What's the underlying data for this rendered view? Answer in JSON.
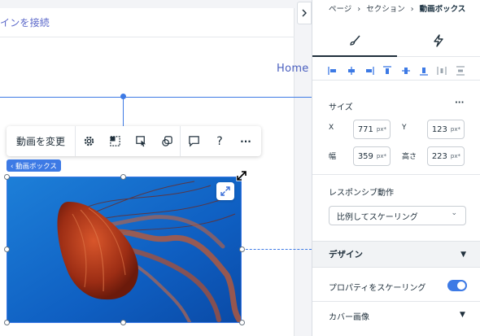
{
  "canvas": {
    "connect_text": "インを接続",
    "home_link": "Home",
    "badge": "‹ 動画ボックス",
    "toolbar": {
      "change_label": "動画を変更",
      "help_label": "?",
      "more_label": "···"
    }
  },
  "panel": {
    "breadcrumb": {
      "part1": "ページ",
      "sep": "›",
      "part2": "セクション",
      "part3": "動画ボックス"
    },
    "size": {
      "label": "サイズ",
      "more": "···",
      "x_label": "X",
      "x_value": "771",
      "y_label": "Y",
      "y_value": "123",
      "w_label": "幅",
      "w_value": "359",
      "h_label": "高さ",
      "h_value": "223",
      "unit": "px*"
    },
    "responsive": {
      "label": "レスポンシブ動作",
      "selected": "比例してスケーリング"
    },
    "design": {
      "label": "デザイン"
    },
    "scale_props": {
      "label": "プロパティをスケーリング",
      "enabled": true
    },
    "cover": {
      "label": "カバー画像"
    }
  },
  "colors": {
    "accent": "#3d7ae5",
    "link": "#4a5fbf",
    "text": "#20303c"
  }
}
